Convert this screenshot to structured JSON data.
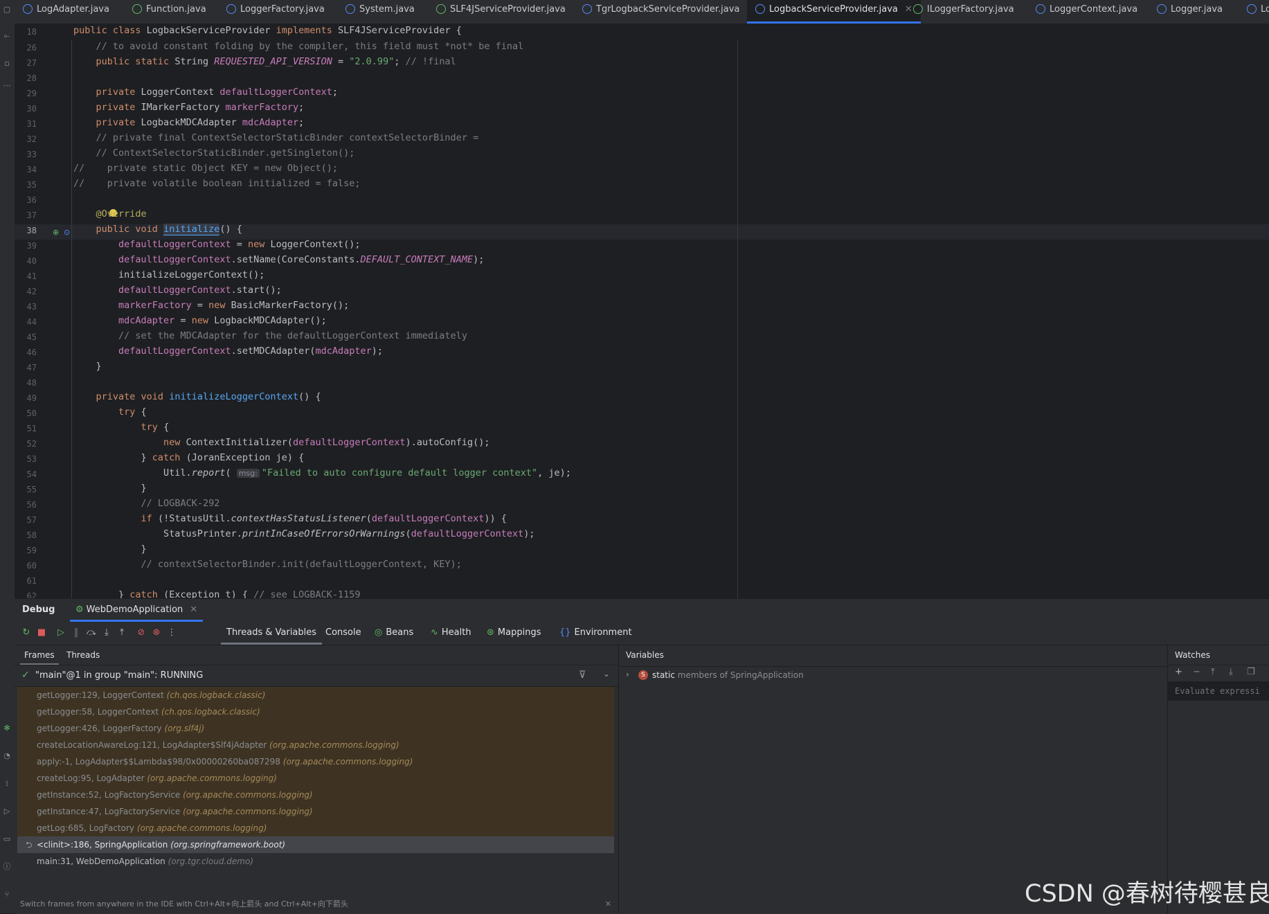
{
  "tabs": [
    {
      "label": "LogAdapter.java",
      "kind": "class"
    },
    {
      "label": "Function.java",
      "kind": "interface"
    },
    {
      "label": "LoggerFactory.java",
      "kind": "class"
    },
    {
      "label": "System.java",
      "kind": "class"
    },
    {
      "label": "SLF4JServiceProvider.java",
      "kind": "interface"
    },
    {
      "label": "TgrLogbackServiceProvider.java",
      "kind": "class"
    },
    {
      "label": "LogbackServiceProvider.java",
      "kind": "class",
      "active": true
    },
    {
      "label": "ILoggerFactory.java",
      "kind": "interface"
    },
    {
      "label": "LoggerContext.java",
      "kind": "class"
    },
    {
      "label": "Logger.java",
      "kind": "class"
    },
    {
      "label": "Lo",
      "kind": "class"
    }
  ],
  "editor": {
    "current_line": "38",
    "line_numbers": [
      "18",
      "26",
      "27",
      "28",
      "29",
      "30",
      "31",
      "32",
      "33",
      "34",
      "35",
      "36",
      "37",
      "38",
      "39",
      "40",
      "41",
      "42",
      "43",
      "44",
      "45",
      "46",
      "47",
      "48",
      "49",
      "50",
      "51",
      "52",
      "53",
      "54",
      "55",
      "56",
      "57",
      "58",
      "59",
      "60",
      "61",
      "62"
    ]
  },
  "debug": {
    "title": "Debug",
    "session": "WebDemoApplication",
    "views": [
      {
        "label": "Threads & Variables",
        "icon": ""
      },
      {
        "label": "Console",
        "icon": ""
      },
      {
        "label": "Beans",
        "icon": "bean-icon"
      },
      {
        "label": "Health",
        "icon": "health-icon"
      },
      {
        "label": "Mappings",
        "icon": "mappings-icon"
      },
      {
        "label": "Environment",
        "icon": "environment-icon"
      }
    ],
    "frames_tab": "Frames",
    "threads_tab": "Threads",
    "thread": "\"main\"@1 in group \"main\": RUNNING",
    "frames": [
      {
        "method": "getLogger:129, LoggerContext",
        "pkg": "(ch.qos.logback.classic)"
      },
      {
        "method": "getLogger:58, LoggerContext",
        "pkg": "(ch.qos.logback.classic)"
      },
      {
        "method": "getLogger:426, LoggerFactory",
        "pkg": "(org.slf4j)"
      },
      {
        "method": "createLocationAwareLog:121, LogAdapter$Slf4jAdapter",
        "pkg": "(org.apache.commons.logging)"
      },
      {
        "method": "apply:-1, LogAdapter$$Lambda$98/0x00000260ba087298",
        "pkg": "(org.apache.commons.logging)"
      },
      {
        "method": "createLog:95, LogAdapter",
        "pkg": "(org.apache.commons.logging)"
      },
      {
        "method": "getInstance:52, LogFactoryService",
        "pkg": "(org.apache.commons.logging)"
      },
      {
        "method": "getInstance:47, LogFactoryService",
        "pkg": "(org.apache.commons.logging)"
      },
      {
        "method": "getLog:685, LogFactory",
        "pkg": "(org.apache.commons.logging)"
      },
      {
        "method": "<clinit>:186, SpringApplication",
        "pkg": "(org.springframework.boot)"
      },
      {
        "method": "main:31, WebDemoApplication",
        "pkg": "(org.tgr.cloud.demo)"
      }
    ],
    "hint": "Switch frames from anywhere in the IDE with Ctrl+Alt+向上箭头 and Ctrl+Alt+向下箭头",
    "variables_title": "Variables",
    "variable_row": {
      "name": "static",
      "desc": "members of SpringApplication"
    },
    "watches_title": "Watches",
    "watches_placeholder": "Evaluate expressi"
  },
  "watermark": "CSDN @春树待樱甚良",
  "colors": {
    "accent": "#3574f0",
    "frame_bg": "#3e3322",
    "keyword": "#cf8e6d",
    "field": "#c77dbb",
    "string": "#6aab73",
    "comment": "#7a7e85",
    "method": "#56a8f5"
  }
}
